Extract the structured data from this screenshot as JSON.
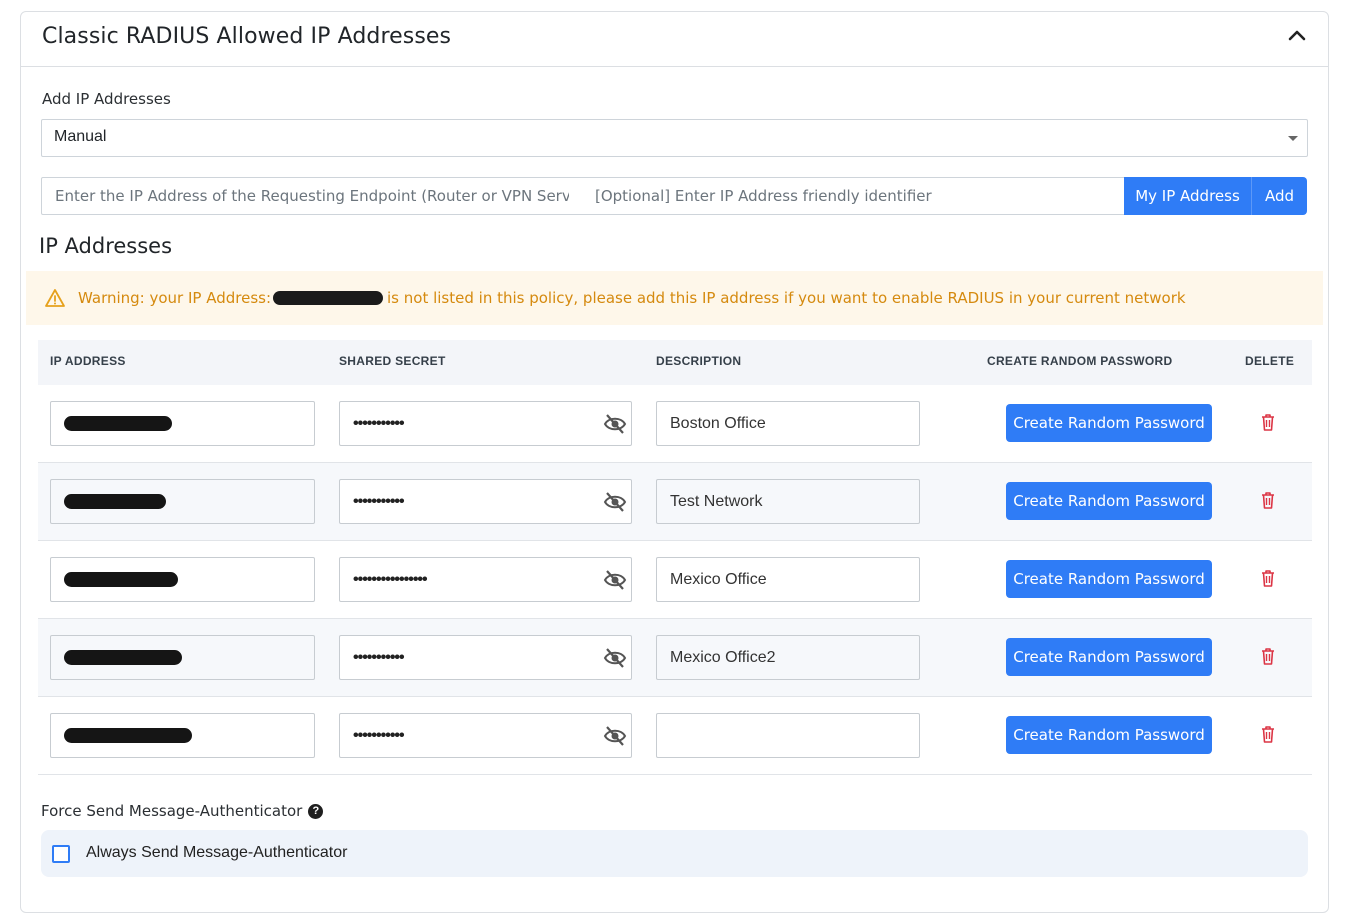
{
  "card": {
    "title": "Classic RADIUS Allowed IP Addresses"
  },
  "add_ip": {
    "label": "Add IP Addresses",
    "mode_selected": "Manual",
    "ip_placeholder": "Enter the IP Address of the Requesting Endpoint (Router or VPN Server)",
    "identifier_placeholder": "[Optional] Enter IP Address friendly identifier",
    "my_ip_button": "My IP Address",
    "add_button": "Add"
  },
  "ip_section": {
    "title": "IP Addresses",
    "warning_prefix": "Warning: your IP Address:",
    "warning_suffix": "is not listed in this policy, please add this IP address if you want to enable RADIUS in your current network"
  },
  "table": {
    "headers": [
      "IP ADDRESS",
      "SHARED SECRET",
      "DESCRIPTION",
      "CREATE RANDOM PASSWORD",
      "DELETE"
    ],
    "rows": [
      {
        "secret": "•••••••••••",
        "description": "Boston Office",
        "button": "Create Random Password"
      },
      {
        "secret": "•••••••••••",
        "description": "Test Network",
        "button": "Create Random Password"
      },
      {
        "secret": "••••••••••••••••",
        "description": "Mexico Office",
        "button": "Create Random Password"
      },
      {
        "secret": "•••••••••••",
        "description": "Mexico Office2",
        "button": "Create Random Password"
      },
      {
        "secret": "•••••••••••",
        "description": "",
        "button": "Create Random Password"
      }
    ]
  },
  "force_send": {
    "label": "Force Send Message-Authenticator",
    "help_icon": "question-circle-icon",
    "checkbox_label": "Always Send Message-Authenticator",
    "checked": false
  },
  "colors": {
    "primary": "#2f7cf6",
    "warning_text": "#d58a0f",
    "warning_bg": "#fef7ea",
    "delete_icon": "#dc3545"
  }
}
